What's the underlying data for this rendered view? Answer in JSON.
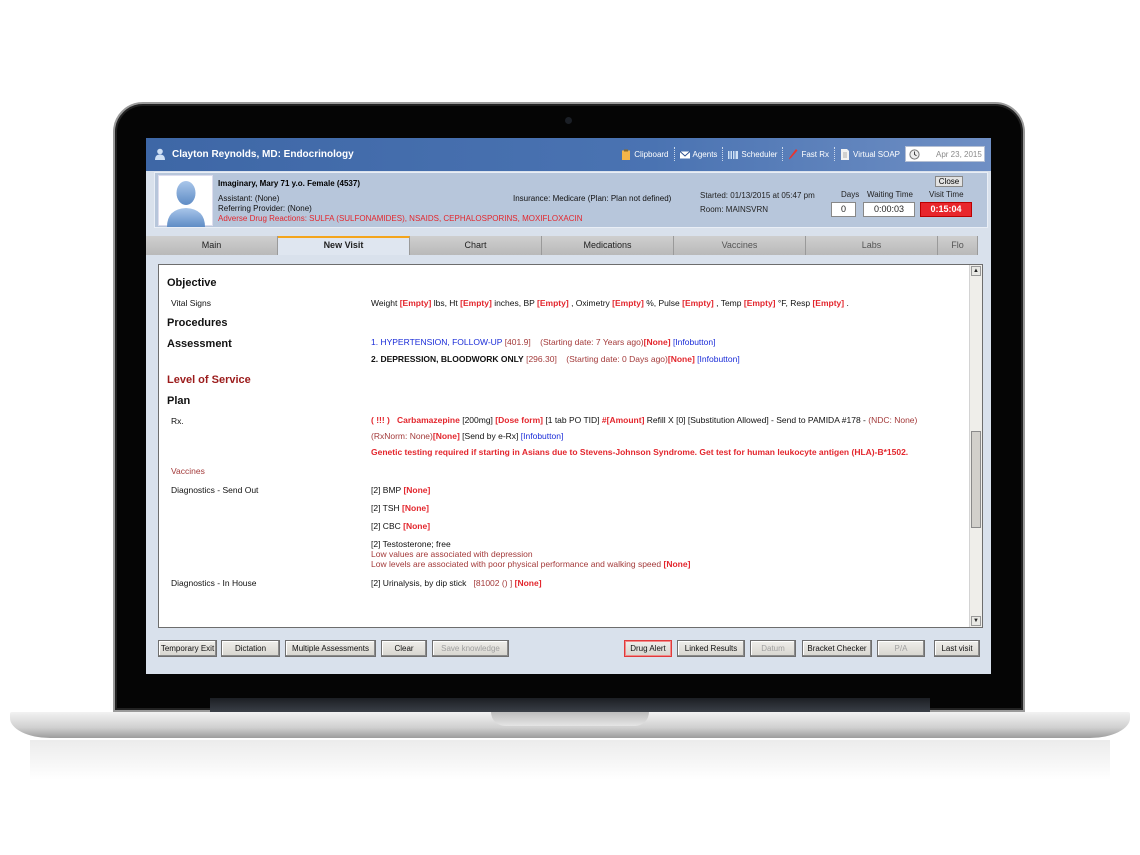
{
  "header": {
    "title": "Clayton Reynolds, MD: Endocrinology",
    "toolbar": [
      {
        "label": "Clipboard",
        "icon": "clipboard-icon"
      },
      {
        "label": "Agents",
        "icon": "envelope-icon"
      },
      {
        "label": "Scheduler",
        "icon": "calendar-icon"
      },
      {
        "label": "Fast Rx",
        "icon": "pen-icon"
      },
      {
        "label": "Virtual SOAP",
        "icon": "document-icon"
      }
    ],
    "date": "Apr 23, 2015"
  },
  "patient": {
    "name": "Imaginary, Mary 71 y.o. Female (4537)",
    "assistant": "Assistant: (None)",
    "referring": "Referring Provider: (None)",
    "adverse": "Adverse Drug Reactions: SULFA (SULFONAMIDES), NSAIDS, CEPHALOSPORINS, MOXIFLOXACIN",
    "insurance": "Insurance: Medicare (Plan: Plan not defined)",
    "started": "Started: 01/13/2015 at 05:47 pm",
    "room": "Room: MAINSVRN",
    "close_label": "Close",
    "days_label": "Days",
    "days": "0",
    "waiting_label": "Waiting Time",
    "waiting": "0:00:03",
    "visit_label": "Visit Time",
    "visit": "0:15:04"
  },
  "tabs": [
    {
      "label": "Main"
    },
    {
      "label": "New Visit",
      "active": true
    },
    {
      "label": "Chart"
    },
    {
      "label": "Medications"
    },
    {
      "label": "Vaccines"
    },
    {
      "label": "Labs"
    },
    {
      "label": "Flo"
    }
  ],
  "note": {
    "objective": "Objective",
    "vital_signs_label": "Vital Signs",
    "vitals": {
      "weight": "Weight",
      "weight_unit": "lbs, Ht",
      "ht_unit": "inches, BP",
      "bp_after": ", Oximetry",
      "ox_unit": "%, Pulse",
      "pulse_after": ", Temp",
      "temp_unit": "°F, Resp",
      "resp_after": ".",
      "empty": "[Empty]"
    },
    "procedures": "Procedures",
    "assessment": "Assessment",
    "assessments": [
      {
        "text": "1. HYPERTENSION, FOLLOW-UP",
        "code": "[401.9]",
        "start": "(Starting date: 7 Years ago)",
        "none": "[None]",
        "info": "[Infobutton]"
      },
      {
        "text": "2. DEPRESSION, BLOODWORK ONLY",
        "code": "[296.30]",
        "start": "(Starting date: 0 Days ago)",
        "none": "[None]",
        "info": "[Infobutton]"
      }
    ],
    "level_of_service": "Level of Service",
    "plan": "Plan",
    "rx_label": "Rx.",
    "rx": {
      "alert": "( !!! )",
      "drug": "Carbamazepine",
      "strength": "[200mg]",
      "dose_form": "[Dose form]",
      "sig": "[1 tab PO TID]",
      "amount": "#[Amount]",
      "refill": "Refill X [0] [Substitution Allowed] - Send to PAMIDA #178 -",
      "ndc": "(NDC: None)",
      "rxnorm": "(RxNorm: None)",
      "none": "[None]",
      "send": "[Send by e-Rx]",
      "info": "[Infobutton]",
      "warning": "Genetic testing required if starting in Asians due to Stevens-Johnson Syndrome. Get test for human leukocyte antigen (HLA)-B*1502."
    },
    "vaccines": "Vaccines",
    "diag_send_label": "Diagnostics - Send Out",
    "diag_send": [
      {
        "text": "[2] BMP",
        "none": "[None]"
      },
      {
        "text": "[2] TSH",
        "none": "[None]"
      },
      {
        "text": "[2] CBC",
        "none": "[None]"
      }
    ],
    "testosterone": {
      "text": "[2] Testosterone; free",
      "note1": "Low values are associated with depression",
      "note2": "Low levels are associated with poor physical performance and walking speed",
      "none": "[None]"
    },
    "diag_house_label": "Diagnostics - In House",
    "diag_house": {
      "text": "[2] Urinalysis, by dip stick",
      "code": "[81002  () ]",
      "none": "[None]"
    }
  },
  "buttons": {
    "temporary_exit": "Temporary Exit",
    "dictation": "Dictation",
    "multiple_assessments": "Multiple Assessments",
    "clear": "Clear",
    "save_knowledge": "Save knowledge",
    "drug_alert": "Drug Alert",
    "linked_results": "Linked Results",
    "datum": "Datum",
    "bracket_checker": "Bracket Checker",
    "pa": "P/A",
    "last_visit": "Last visit"
  }
}
